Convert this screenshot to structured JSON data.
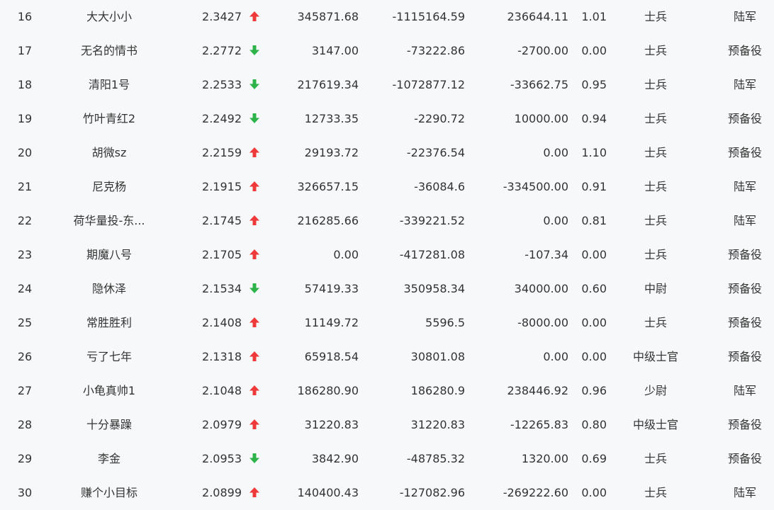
{
  "colors": {
    "up": "#f03a3a",
    "down": "#2db34a",
    "background": "#f7f8fa",
    "text": "#333333"
  },
  "rows": [
    {
      "rank": "16",
      "name": "大大小小",
      "score": "2.3427",
      "trend": "up",
      "v1": "345871.68",
      "v2": "-1115164.59",
      "v3": "236644.11",
      "ratio": "1.01",
      "title": "士兵",
      "branch": "陆军"
    },
    {
      "rank": "17",
      "name": "无名的情书",
      "score": "2.2772",
      "trend": "down",
      "v1": "3147.00",
      "v2": "-73222.86",
      "v3": "-2700.00",
      "ratio": "0.00",
      "title": "士兵",
      "branch": "预备役"
    },
    {
      "rank": "18",
      "name": "清阳1号",
      "score": "2.2533",
      "trend": "down",
      "v1": "217619.34",
      "v2": "-1072877.12",
      "v3": "-33662.75",
      "ratio": "0.95",
      "title": "士兵",
      "branch": "陆军"
    },
    {
      "rank": "19",
      "name": "竹叶青红2",
      "score": "2.2492",
      "trend": "down",
      "v1": "12733.35",
      "v2": "-2290.72",
      "v3": "10000.00",
      "ratio": "0.94",
      "title": "士兵",
      "branch": "预备役"
    },
    {
      "rank": "20",
      "name": "胡微sz",
      "score": "2.2159",
      "trend": "up",
      "v1": "29193.72",
      "v2": "-22376.54",
      "v3": "0.00",
      "ratio": "1.10",
      "title": "士兵",
      "branch": "预备役"
    },
    {
      "rank": "21",
      "name": "尼克杨",
      "score": "2.1915",
      "trend": "up",
      "v1": "326657.15",
      "v2": "-36084.6",
      "v3": "-334500.00",
      "ratio": "0.91",
      "title": "士兵",
      "branch": "陆军"
    },
    {
      "rank": "22",
      "name": "荷华量投-东...",
      "score": "2.1745",
      "trend": "up",
      "v1": "216285.66",
      "v2": "-339221.52",
      "v3": "0.00",
      "ratio": "0.81",
      "title": "士兵",
      "branch": "陆军"
    },
    {
      "rank": "23",
      "name": "期魔八号",
      "score": "2.1705",
      "trend": "up",
      "v1": "0.00",
      "v2": "-417281.08",
      "v3": "-107.34",
      "ratio": "0.00",
      "title": "士兵",
      "branch": "预备役"
    },
    {
      "rank": "24",
      "name": "隐休泽",
      "score": "2.1534",
      "trend": "down",
      "v1": "57419.33",
      "v2": "350958.34",
      "v3": "34000.00",
      "ratio": "0.60",
      "title": "中尉",
      "branch": "预备役"
    },
    {
      "rank": "25",
      "name": "常胜胜利",
      "score": "2.1408",
      "trend": "up",
      "v1": "11149.72",
      "v2": "5596.5",
      "v3": "-8000.00",
      "ratio": "0.00",
      "title": "士兵",
      "branch": "预备役"
    },
    {
      "rank": "26",
      "name": "亏了七年",
      "score": "2.1318",
      "trend": "up",
      "v1": "65918.54",
      "v2": "30801.08",
      "v3": "0.00",
      "ratio": "0.00",
      "title": "中级士官",
      "branch": "预备役"
    },
    {
      "rank": "27",
      "name": "小龟真帅1",
      "score": "2.1048",
      "trend": "up",
      "v1": "186280.90",
      "v2": "186280.9",
      "v3": "238446.92",
      "ratio": "0.96",
      "title": "少尉",
      "branch": "陆军"
    },
    {
      "rank": "28",
      "name": "十分暴躁",
      "score": "2.0979",
      "trend": "up",
      "v1": "31220.83",
      "v2": "31220.83",
      "v3": "-12265.83",
      "ratio": "0.80",
      "title": "中级士官",
      "branch": "预备役"
    },
    {
      "rank": "29",
      "name": "李金",
      "score": "2.0953",
      "trend": "down",
      "v1": "3842.90",
      "v2": "-48785.32",
      "v3": "1320.00",
      "ratio": "0.69",
      "title": "士兵",
      "branch": "预备役"
    },
    {
      "rank": "30",
      "name": "赚个小目标",
      "score": "2.0899",
      "trend": "up",
      "v1": "140400.43",
      "v2": "-127082.96",
      "v3": "-269222.60",
      "ratio": "0.00",
      "title": "士兵",
      "branch": "陆军"
    }
  ]
}
